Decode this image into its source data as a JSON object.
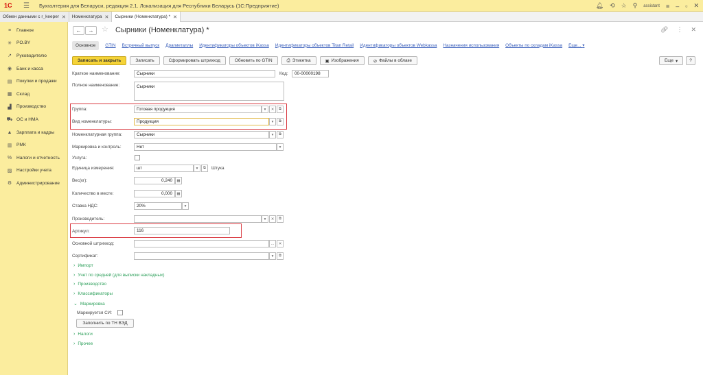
{
  "window": {
    "logo": "1С",
    "title": "Бухгалтерия для Беларуси, редакция 2.1. Локализация для Республики Беларусь   (1С:Предприятие)",
    "user": "assistant"
  },
  "tabs": [
    {
      "label": "Обмен данными с r_keeper"
    },
    {
      "label": "Номенклатура"
    },
    {
      "label": "Сырники (Номенклатура) *"
    }
  ],
  "sidebar": {
    "items": [
      {
        "label": "Главное",
        "icon": "≡"
      },
      {
        "label": "PO.BY",
        "icon": "✳"
      },
      {
        "label": "Руководителю",
        "icon": "↗"
      },
      {
        "label": "Банк и касса",
        "icon": "◉"
      },
      {
        "label": "Покупки и продажи",
        "icon": "▤"
      },
      {
        "label": "Склад",
        "icon": "▦"
      },
      {
        "label": "Производство",
        "icon": "▟"
      },
      {
        "label": "ОС и НМА",
        "icon": "⛟"
      },
      {
        "label": "Зарплата и кадры",
        "icon": "▲"
      },
      {
        "label": "РМК",
        "icon": "▥"
      },
      {
        "label": "Налоги и отчетность",
        "icon": "%"
      },
      {
        "label": "Настройки учета",
        "icon": "▨"
      },
      {
        "label": "Администрирование",
        "icon": "⚙"
      }
    ]
  },
  "form": {
    "title": "Сырники (Номенклатура) *",
    "links": {
      "current": "Основное",
      "items": [
        "GTIN",
        "Встречный выпуск",
        "Драгметаллы",
        "Идентификаторы объектов iKassa",
        "Идентификаторы объектов Titan Retail",
        "Идентификаторы объектов Webkassa",
        "Назначения использования",
        "Объекты по складам iKassa",
        "Еще..."
      ]
    },
    "toolbar": {
      "save_close": "Записать и закрыть",
      "save": "Записать",
      "barcode": "Сформировать штрихкод",
      "update_gtin": "Обновить по GTIN",
      "label": "Этикетка",
      "images": "Изображения",
      "cloud": "Файлы в облаке",
      "more": "Еще",
      "help": "?"
    },
    "fields": {
      "short_name_label": "Краткое наименование:",
      "short_name": "Сырники",
      "code_label": "Код:",
      "code": "00-00000198",
      "full_name_label": "Полное наименование:",
      "full_name": "Сырники",
      "group_label": "Группа:",
      "group": "Готовая продукция",
      "kind_label": "Вид номенклатуры:",
      "kind": "Продукция",
      "nom_group_label": "Номенклатурная группа:",
      "nom_group": "Сырники",
      "marking_label": "Маркировка и контроль:",
      "marking": "Нет",
      "service_label": "Услуга:",
      "unit_label": "Единица измерения:",
      "unit": "шт",
      "unit_name": "Штука",
      "weight_label": "Вес(кг):",
      "weight": "0,240",
      "qty_label": "Количество в месте:",
      "qty": "0,000",
      "vat_label": "Ставка НДС:",
      "vat": "20%",
      "maker_label": "Производитель:",
      "maker": "",
      "article_label": "Артикул:",
      "article": "116",
      "barcode_label": "Основной штрихкод:",
      "barcode": "",
      "cert_label": "Сертификат:",
      "cert": ""
    },
    "groups": {
      "import": "Импорт",
      "avg": "Учет по средней (для выписки накладных)",
      "production": "Производство",
      "classifiers": "Классификаторы",
      "marking": "Маркировка",
      "marking_ci": "Маркируется СИ:",
      "fill_tn": "Заполнить по ТН ВЭД",
      "taxes": "Налоги",
      "other": "Прочее"
    }
  }
}
